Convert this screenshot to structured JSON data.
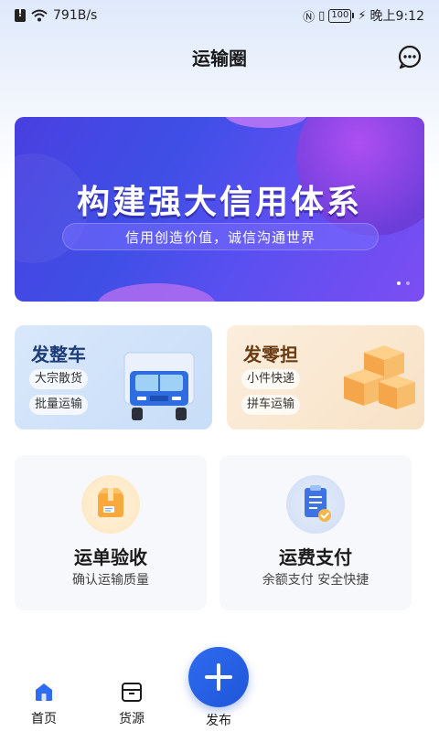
{
  "status_bar": {
    "net_speed": "791B/s",
    "battery": "100",
    "time": "晚上9:12"
  },
  "header": {
    "title": "运输圈"
  },
  "banner": {
    "headline": "构建强大信用体系",
    "slogan": "信用创造价值，诚信沟通世界"
  },
  "services": [
    {
      "title": "发整车",
      "tags": [
        "大宗散货",
        "批量运输"
      ]
    },
    {
      "title": "发零担",
      "tags": [
        "小件快递",
        "拼车运输"
      ]
    }
  ],
  "features": [
    {
      "title": "运单验收",
      "subtitle": "确认运输质量"
    },
    {
      "title": "运费支付",
      "subtitle": "余额支付 安全快捷"
    }
  ],
  "bottom_nav": {
    "home": "首页",
    "goods": "货源",
    "publish": "发布"
  },
  "colors": {
    "accent": "#2f6cf0",
    "banner": "#4a3fe0"
  }
}
